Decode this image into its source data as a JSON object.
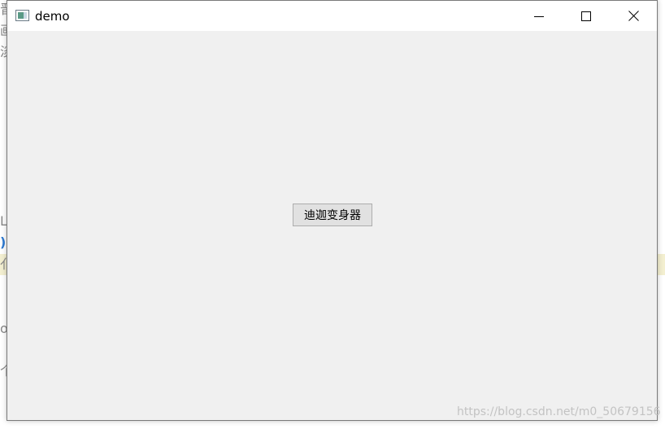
{
  "window": {
    "title": "demo",
    "controls": {
      "minimize": "minimize",
      "maximize": "maximize",
      "close": "close"
    }
  },
  "main": {
    "button_label": "迪迦变身器"
  },
  "background": {
    "fragments": [
      "晋",
      "画",
      "淡",
      "Lr",
      ")",
      "亻",
      "oc",
      "个"
    ]
  },
  "watermark": {
    "text": "https://blog.csdn.net/m0_50679156"
  },
  "colors": {
    "window_bg": "#f0f0f0",
    "titlebar_bg": "#ffffff",
    "button_bg": "#e1e1e1",
    "button_border": "#adadad"
  }
}
